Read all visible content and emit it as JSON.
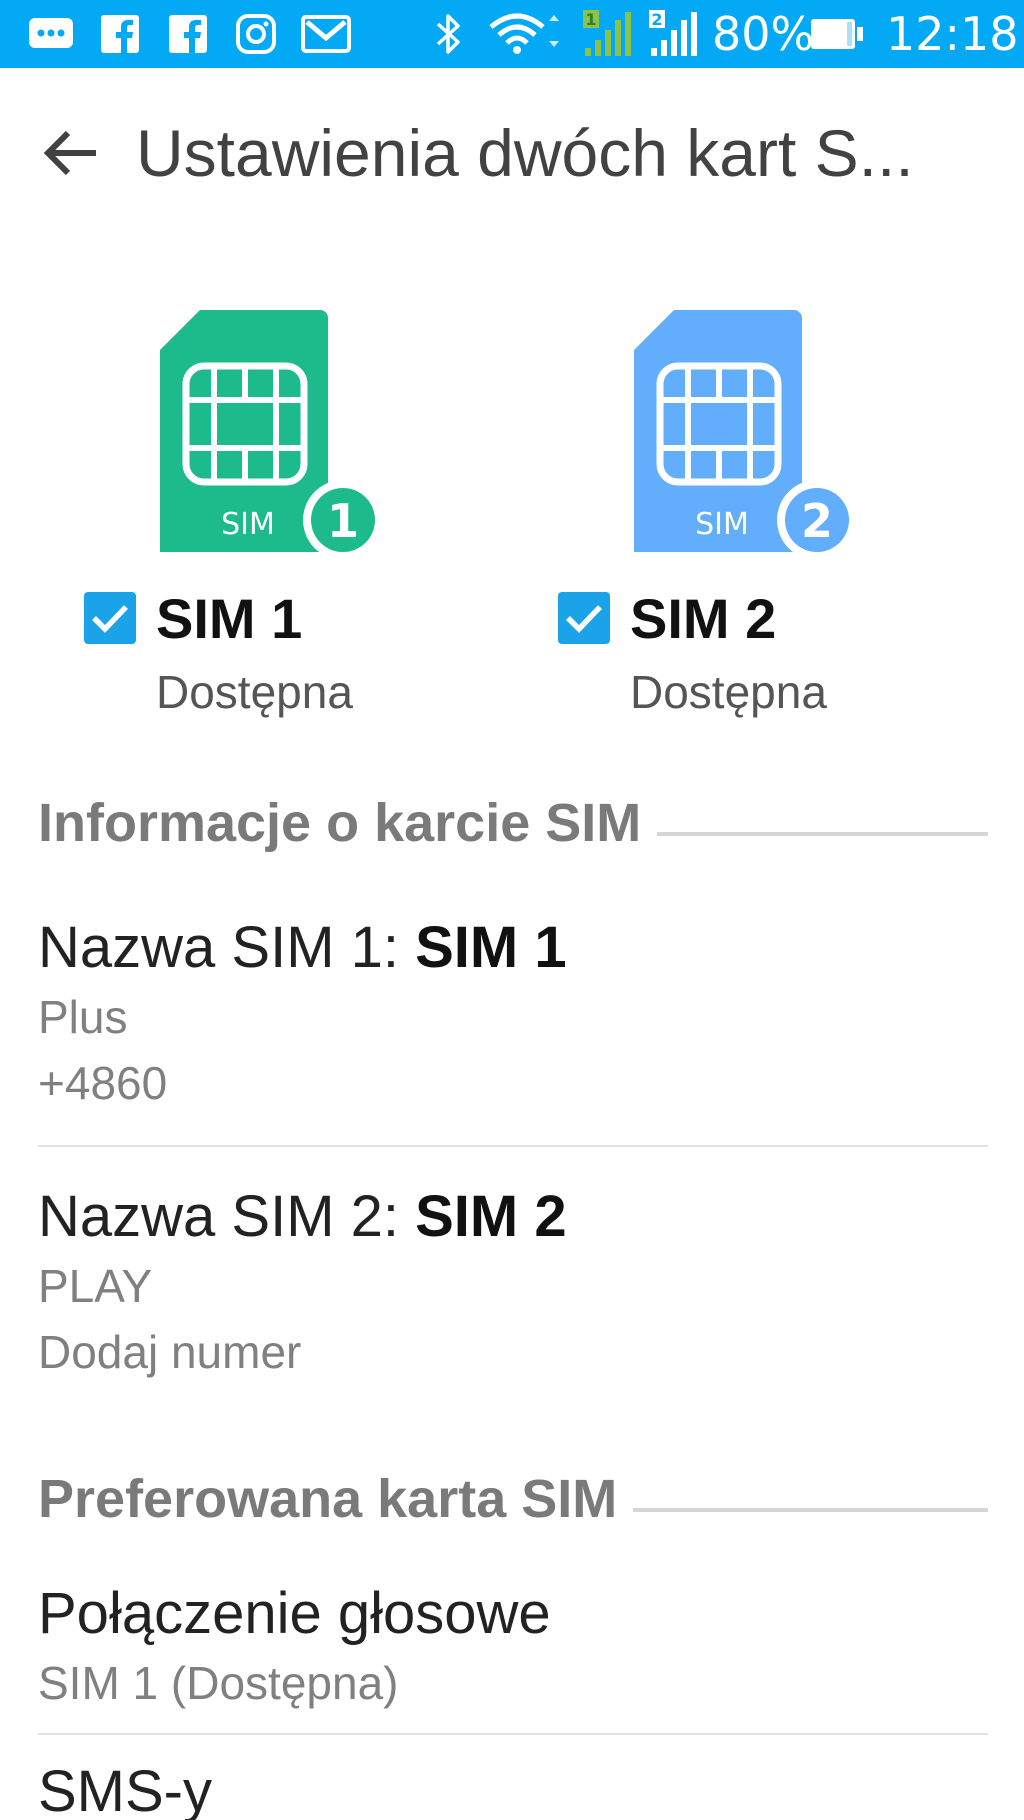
{
  "status_bar": {
    "battery": "80%",
    "time": "12:18",
    "background": "#03a9f4",
    "sim1_signal_label": "1",
    "sim2_signal_label": "2",
    "icons": [
      "chat-icon",
      "facebook-icon",
      "facebook-icon",
      "instagram-icon",
      "gmail-icon",
      "bluetooth-icon",
      "wifi-icon",
      "signal-sim1-icon",
      "signal-sim2-icon",
      "battery-icon"
    ]
  },
  "app_bar": {
    "title": "Ustawienia dwóch kart S..."
  },
  "sims": [
    {
      "name": "SIM 1",
      "status": "Dostępna",
      "checked": true,
      "card_label": "SIM",
      "badge": "1",
      "color": "#1dba8b"
    },
    {
      "name": "SIM 2",
      "status": "Dostępna",
      "checked": true,
      "card_label": "SIM",
      "badge": "2",
      "color": "#63aefc"
    }
  ],
  "sim_info": {
    "header": "Informacje o karcie SIM",
    "items": [
      {
        "label": "Nazwa SIM 1: ",
        "value": "SIM 1",
        "operator": "Plus",
        "number": "+4860"
      },
      {
        "label": "Nazwa SIM 2: ",
        "value": "SIM 2",
        "operator": "PLAY",
        "number": "Dodaj numer"
      }
    ]
  },
  "preferred": {
    "header": "Preferowana karta SIM",
    "items": [
      {
        "title": "Połączenie głosowe",
        "value": "SIM 1 (Dostępna)"
      },
      {
        "title": "SMS-y"
      }
    ]
  },
  "colors": {
    "accent": "#1aa3e8",
    "sim1": "#1dba8b",
    "sim2": "#63aefc",
    "section_header": "#7a7a7a"
  }
}
